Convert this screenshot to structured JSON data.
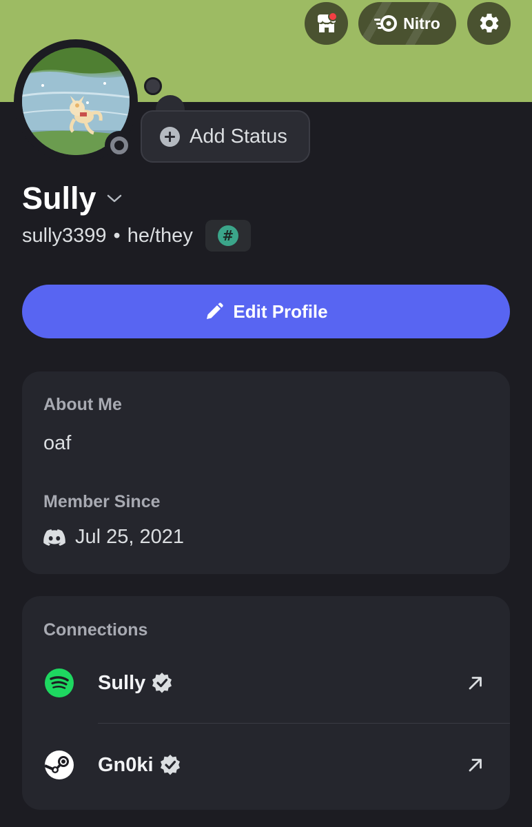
{
  "colors": {
    "banner": "#9dbb63",
    "background": "#1c1c22",
    "card": "#25262d",
    "accent": "#5865f2",
    "spotify": "#1ed760",
    "notification": "#f23f43",
    "offline": "#80848e"
  },
  "top_bar": {
    "shop_icon": "shop-icon",
    "nitro_label": "Nitro",
    "nitro_icon": "nitro-icon",
    "settings_icon": "gear-icon"
  },
  "status": {
    "add_label": "Add Status",
    "presence": "offline"
  },
  "profile": {
    "display_name": "Sully",
    "username": "sully3399",
    "separator": "•",
    "pronouns": "he/they",
    "badge_symbol": "#",
    "edit_label": "Edit Profile"
  },
  "about": {
    "heading": "About Me",
    "text": "oaf",
    "member_heading": "Member Since",
    "member_date": "Jul 25, 2021"
  },
  "connections": {
    "heading": "Connections",
    "items": [
      {
        "service": "spotify",
        "name": "Sully",
        "verified": true
      },
      {
        "service": "steam",
        "name": "Gn0ki",
        "verified": true
      }
    ]
  }
}
